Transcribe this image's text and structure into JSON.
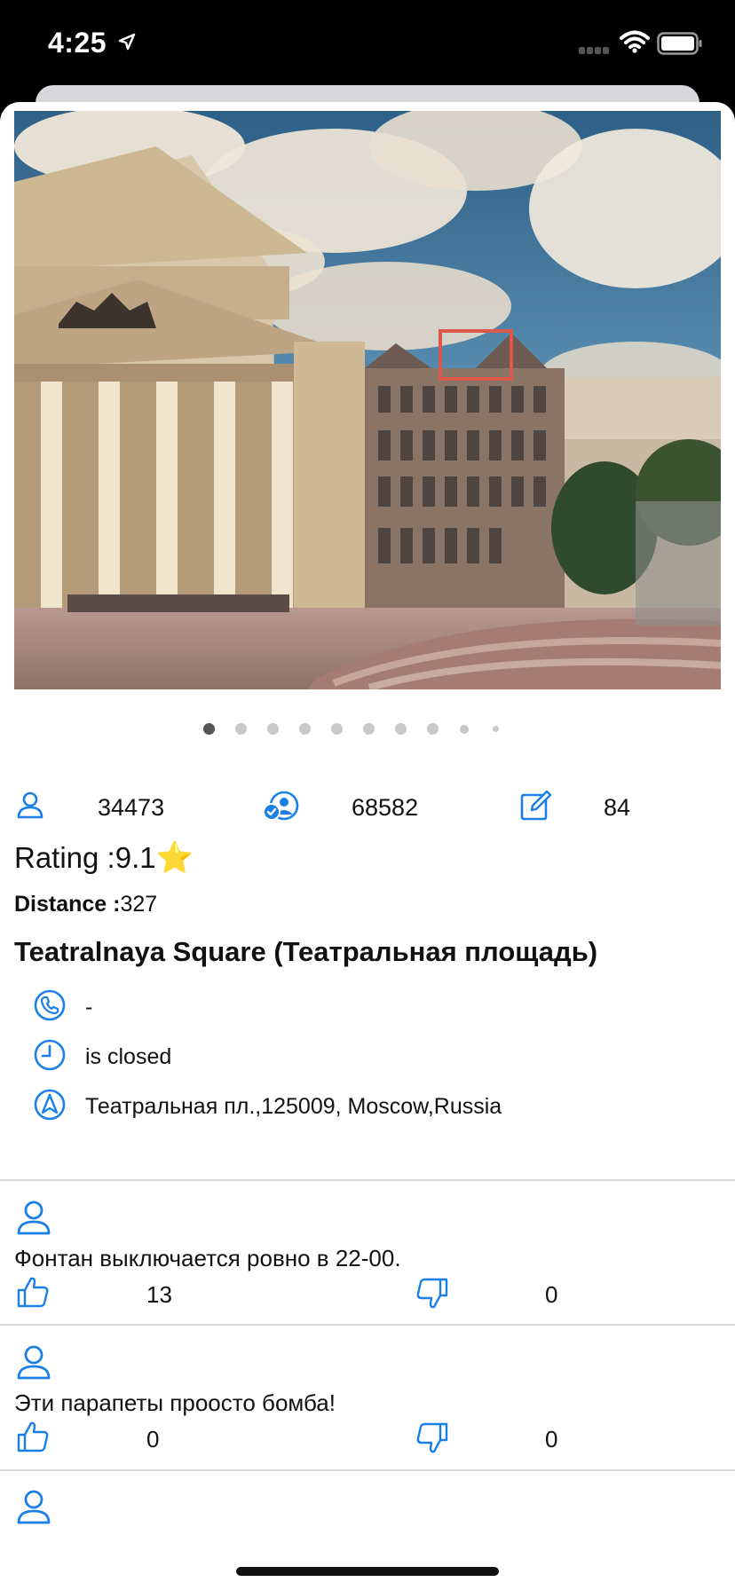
{
  "status_bar": {
    "time": "4:25",
    "location_icon": "location-arrow-icon",
    "signal_icon": "cellular-signal-icon",
    "wifi_icon": "wifi-icon",
    "battery_icon": "battery-icon"
  },
  "gallery": {
    "image_description_icon": "photo",
    "page_count": 10,
    "current_page": 1
  },
  "stats": {
    "visitors": "34473",
    "checkins": "68582",
    "reviews": "84"
  },
  "rating": {
    "label": "Rating :",
    "value": "9.1",
    "star": "⭐"
  },
  "distance": {
    "label": "Distance :",
    "value": "327"
  },
  "place": {
    "name": "Teatralnaya Square (Театральная площадь)",
    "phone": "-",
    "hours": "is closed",
    "address": "Театральная пл.,125009, Moscow,Russia"
  },
  "comments": [
    {
      "text": "Фонтан выключается ровно в 22-00.",
      "likes": "13",
      "dislikes": "0"
    },
    {
      "text": "Эти парапеты проосто бомба!",
      "likes": "0",
      "dislikes": "0"
    },
    {
      "text": "",
      "likes": "",
      "dislikes": ""
    }
  ],
  "colors": {
    "accent": "#1a7fe6",
    "background": "#ffffff",
    "divider": "#d9d9d9"
  }
}
